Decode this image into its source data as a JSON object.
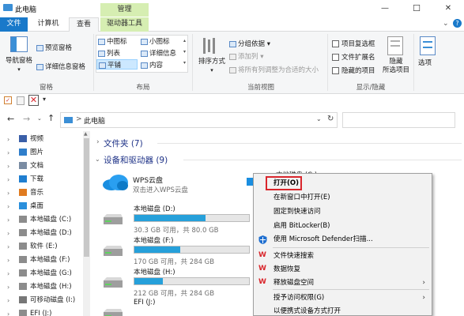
{
  "window": {
    "title": "此电脑",
    "context_tab": "管理",
    "minimize": "—",
    "maximize": "☐",
    "close": "✕"
  },
  "ribbon_tabs": [
    "文件",
    "计算机",
    "查看",
    "驱动器工具"
  ],
  "ribbon": {
    "panes": {
      "nav_pane": "导航窗格",
      "preview_pane": "预览窗格",
      "details_pane": "详细信息窗格",
      "group_label": "窗格"
    },
    "layout": {
      "items": [
        "中图标",
        "小图标",
        "列表",
        "详细信息",
        "平铺",
        "内容"
      ],
      "selected": "平铺",
      "group_label": "布局"
    },
    "current_view": {
      "sort": "排序方式",
      "group_by": "分组依据",
      "add_columns": "添加列",
      "fit_columns": "将所有列调整为合适的大小",
      "group_label": "当前视图"
    },
    "show_hide": {
      "item_checkboxes": "项目复选框",
      "file_extensions": "文件扩展名",
      "hidden_items": "隐藏的项目",
      "hide_selected": "隐藏\n所选项目",
      "group_label": "显示/隐藏"
    },
    "options": "选项"
  },
  "address": {
    "path": "此电脑",
    "separator": ">",
    "search_placeholder": ""
  },
  "nav_pane": [
    {
      "label": "视频",
      "icon": "video-folder-icon"
    },
    {
      "label": "图片",
      "icon": "pictures-folder-icon"
    },
    {
      "label": "文档",
      "icon": "documents-folder-icon"
    },
    {
      "label": "下载",
      "icon": "downloads-folder-icon"
    },
    {
      "label": "音乐",
      "icon": "music-folder-icon"
    },
    {
      "label": "桌面",
      "icon": "desktop-folder-icon"
    },
    {
      "label": "本地磁盘 (C:)",
      "icon": "drive-icon"
    },
    {
      "label": "本地磁盘 (D:)",
      "icon": "drive-icon"
    },
    {
      "label": "软件 (E:)",
      "icon": "drive-icon"
    },
    {
      "label": "本地磁盘 (F:)",
      "icon": "drive-icon"
    },
    {
      "label": "本地磁盘 (G:)",
      "icon": "drive-icon"
    },
    {
      "label": "本地磁盘 (H:)",
      "icon": "drive-icon"
    },
    {
      "label": "可移动磁盘 (I:)",
      "icon": "usb-drive-icon"
    },
    {
      "label": "EFI (J:)",
      "icon": "drive-icon"
    }
  ],
  "content": {
    "folders_header": "文件夹 (7)",
    "devices_header": "设备和驱动器 (9)",
    "wps": {
      "name": "WPS云盘",
      "subtitle": "双击进入WPS云盘"
    },
    "drives": [
      {
        "name": "本地磁盘 (D:)",
        "free": "30.3 GB 可用，共 80.0 GB",
        "used_fraction": 0.62
      },
      {
        "name": "本地磁盘 (F:)",
        "free": "170 GB 可用，共 284 GB",
        "used_fraction": 0.4
      },
      {
        "name": "本地磁盘 (H:)",
        "free": "212 GB 可用，共 284 GB",
        "used_fraction": 0.25
      },
      {
        "name": "EFI (J:)",
        "free": "",
        "used_fraction": 0
      }
    ],
    "partial_drive_c": "本地磁盘 (C:)"
  },
  "context_menu": [
    {
      "label": "打开(O)",
      "icon": "",
      "highlighted": true
    },
    {
      "label": "在新窗口中打开(E)",
      "icon": ""
    },
    {
      "label": "固定到快速访问",
      "icon": ""
    },
    {
      "label": "启用 BitLocker(B)",
      "icon": ""
    },
    {
      "label": "使用 Microsoft Defender扫描...",
      "icon": "defender-shield-icon"
    },
    {
      "label": "文件快速搜索",
      "icon": "wps-icon"
    },
    {
      "label": "数据恢复",
      "icon": "wps-icon"
    },
    {
      "label": "释放磁盘空间",
      "icon": "wps-icon",
      "submenu": true
    },
    {
      "label": "授予访问权限(G)",
      "icon": "",
      "submenu": true
    },
    {
      "label": "以便携式设备方式打开",
      "icon": ""
    }
  ],
  "colors": {
    "accent": "#1979ca",
    "drive_bar": "#26a0da",
    "context_tab": "#d6eeb2",
    "highlight_box": "#d9262c"
  }
}
